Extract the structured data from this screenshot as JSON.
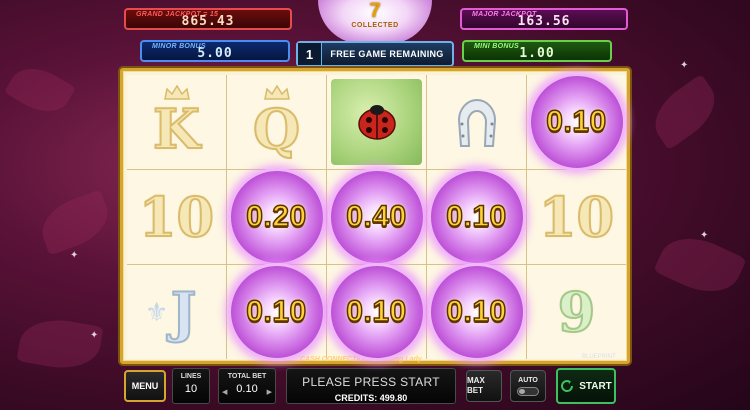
{
  "jackpots": {
    "grand": {
      "label": "GRAND JACKPOT = 15",
      "value": "865.43"
    },
    "major": {
      "label": "MAJOR JACKPOT",
      "value": "163.56"
    },
    "minor": {
      "label": "MINOR BONUS",
      "value": "5.00"
    },
    "mini": {
      "label": "MINI BONUS",
      "value": "1.00"
    }
  },
  "collected": {
    "count": "7",
    "label": "COLLECTED"
  },
  "free_games": {
    "count": "1",
    "label": "FREE GAME REMAINING"
  },
  "reels": [
    [
      "K",
      "Q",
      "ladybug",
      "horseshoe",
      "0.10"
    ],
    [
      "10",
      "0.20",
      "0.40",
      "0.10",
      "10"
    ],
    [
      "J",
      "0.10",
      "0.10",
      "0.10",
      "9"
    ]
  ],
  "cells": {
    "r0c0": "K",
    "r0c1": "Q",
    "r0c4": "0.10",
    "r1c0": "10",
    "r1c1": "0.20",
    "r1c2": "0.40",
    "r1c3": "0.10",
    "r1c4": "10",
    "r2c0": "J",
    "r2c1": "0.10",
    "r2c2": "0.10",
    "r2c3": "0.10",
    "r2c4": "9"
  },
  "logos": {
    "game": "CASH CONNECTION Charming Lady",
    "vendor": "BLUEPRINT"
  },
  "controls": {
    "menu": "MENU",
    "lines_label": "LINES",
    "lines_value": "10",
    "total_bet_label": "TOTAL BET",
    "total_bet_value": "0.10",
    "message": "PLEASE PRESS START",
    "credits": "CREDITS: 499.80",
    "max_bet": "MAX BET",
    "auto": "AUTO",
    "start": "START"
  },
  "colors": {
    "grand": "#e84b4b",
    "major": "#e35ad6",
    "minor": "#4a8ef0",
    "mini": "#69d04a",
    "frame": "#d6a431",
    "coin_text": "#ffd23a"
  }
}
